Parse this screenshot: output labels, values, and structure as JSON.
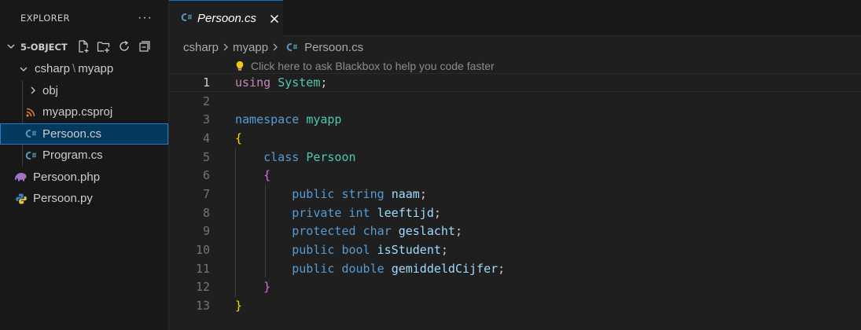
{
  "explorer": {
    "title": "EXPLORER",
    "more_label": "···",
    "project": "5-OBJECT",
    "actions": [
      "new-file-icon",
      "new-folder-icon",
      "refresh-icon",
      "collapse-all-icon"
    ],
    "tree": {
      "folder": {
        "part1": "csharp",
        "sep": "\\",
        "part2": "myapp"
      },
      "obj": "obj",
      "csproj": "myapp.csproj",
      "persoon_cs": "Persoon.cs",
      "program_cs": "Program.cs",
      "persoon_php": "Persoon.php",
      "persoon_py": "Persoon.py"
    }
  },
  "tab": {
    "label": "Persoon.cs"
  },
  "breadcrumb": [
    "csharp",
    "myapp",
    "Persoon.cs"
  ],
  "hint": "Click here to ask Blackbox to help you code faster",
  "line_numbers": [
    "1",
    "2",
    "3",
    "4",
    "5",
    "6",
    "7",
    "8",
    "9",
    "10",
    "11",
    "12",
    "13"
  ],
  "code": {
    "l1": {
      "kw": "using",
      "ns": "System",
      "semi": ";"
    },
    "l3": {
      "kw": "namespace",
      "name": "myapp"
    },
    "l4": {
      "brace": "{"
    },
    "l5": {
      "kw": "class",
      "name": "Persoon"
    },
    "l6": {
      "brace": "{"
    },
    "l7": {
      "mod": "public",
      "type": "string",
      "name": "naam",
      "semi": ";"
    },
    "l8": {
      "mod": "private",
      "type": "int",
      "name": "leeftijd",
      "semi": ";"
    },
    "l9": {
      "mod": "protected",
      "type": "char",
      "name": "geslacht",
      "semi": ";"
    },
    "l10": {
      "mod": "public",
      "type": "bool",
      "name": "isStudent",
      "semi": ";"
    },
    "l11": {
      "mod": "public",
      "type": "double",
      "name": "gemiddeldCijfer",
      "semi": ";"
    },
    "l12": {
      "brace": "}"
    },
    "l13": {
      "brace": "}"
    }
  },
  "colors": {
    "keyword": "#569cd6",
    "type": "#4ec9b0",
    "identifier": "#9cdcfe",
    "bracket1": "#ffd700",
    "bracket2": "#da70d6",
    "selection": "#04395e",
    "accent": "#0078d4"
  }
}
